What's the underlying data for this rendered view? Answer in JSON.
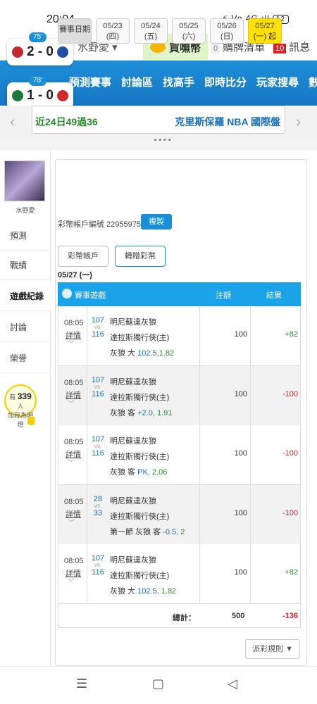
{
  "status": {
    "time": "20:04",
    "icons": "⚡ Vo 4G ıll",
    "battery": "12"
  },
  "topnav": {
    "user": "水野愛 ▾",
    "buy": "買嘸幣",
    "cart_count": "0",
    "cart": "購牌清單",
    "msg_count": "10",
    "msg": "訊息"
  },
  "scores": [
    {
      "minute": "75'",
      "score": "2 - 0"
    },
    {
      "minute": "78'",
      "score": "1 - 0"
    }
  ],
  "menu": [
    "預測賽事",
    "討論區",
    "找高手",
    "即時比分",
    "玩家搜尋",
    "數據"
  ],
  "ticker": {
    "left": "近24日49過36",
    "right": "克里斯保羅 NBA 國際盤"
  },
  "sidebar": {
    "name": "水野愛",
    "items": [
      "預測",
      "戰績",
      "遊戲紀錄",
      "討論",
      "榮譽"
    ],
    "bulb_pre": "有",
    "bulb_count": "339",
    "bulb_suf": "人",
    "bulb_line2": "加我為明燈"
  },
  "dates": {
    "label": "賽事日期",
    "chips": [
      {
        "d": "05/23",
        "w": "(四)"
      },
      {
        "d": "05/24",
        "w": "(五)"
      },
      {
        "d": "05/25",
        "w": "(六)"
      },
      {
        "d": "05/26",
        "w": "(日)"
      },
      {
        "d": "05/27",
        "w": "(一) 起"
      }
    ]
  },
  "account": {
    "text": "彩幣帳戶編號 22955975",
    "copy": "複製"
  },
  "tabs": [
    "彩幣帳戶",
    "轉贈彩幣"
  ],
  "date_header": "05/27 (一)",
  "table": {
    "headers": [
      "賽事遊戲",
      "注額",
      "結果"
    ],
    "detail_label": "詳情",
    "vs": "VS",
    "rows": [
      {
        "time": "08:05",
        "s1": "107",
        "s2": "116",
        "t1": "明尼蘇達灰狼",
        "t2": "達拉斯獨行俠(主)",
        "bet_pre": "灰狼 大 ",
        "bet_line": "102.5",
        "bet_odds": ",1.82",
        "amount": "100",
        "result": "+82",
        "positive": true
      },
      {
        "time": "08:05",
        "s1": "107",
        "s2": "116",
        "t1": "明尼蘇達灰狼",
        "t2": "達拉斯獨行俠(主)",
        "bet_pre": "灰狼 客 ",
        "bet_line": "+2.0",
        "bet_odds": ", 1.91",
        "amount": "100",
        "result": "-100",
        "positive": false
      },
      {
        "time": "08:05",
        "s1": "107",
        "s2": "116",
        "t1": "明尼蘇達灰狼",
        "t2": "達拉斯獨行俠(主)",
        "bet_pre": "灰狼 客 ",
        "bet_line": "PK",
        "bet_odds": ", 2.06",
        "amount": "100",
        "result": "-100",
        "positive": false
      },
      {
        "time": "08:05",
        "s1": "28",
        "s2": "33",
        "t1": "明尼蘇達灰狼",
        "t2": "達拉斯獨行俠(主)",
        "bet_pre": "第一節 灰狼 客 ",
        "bet_line": "-0.5",
        "bet_odds": ", 2",
        "amount": "100",
        "result": "-100",
        "positive": false
      },
      {
        "time": "08:05",
        "s1": "107",
        "s2": "116",
        "t1": "明尼蘇達灰狼",
        "t2": "達拉斯獨行俠(主)",
        "bet_pre": "灰狼 大 ",
        "bet_line": "102.5",
        "bet_odds": ", 1.82",
        "amount": "100",
        "result": "+82",
        "positive": true
      }
    ],
    "total_label": "總計：",
    "total_amount": "500",
    "total_result": "-136"
  },
  "rules": "派彩規則 ▼",
  "nav": {
    "menu": "☰",
    "home": "▢",
    "back": "◁"
  }
}
